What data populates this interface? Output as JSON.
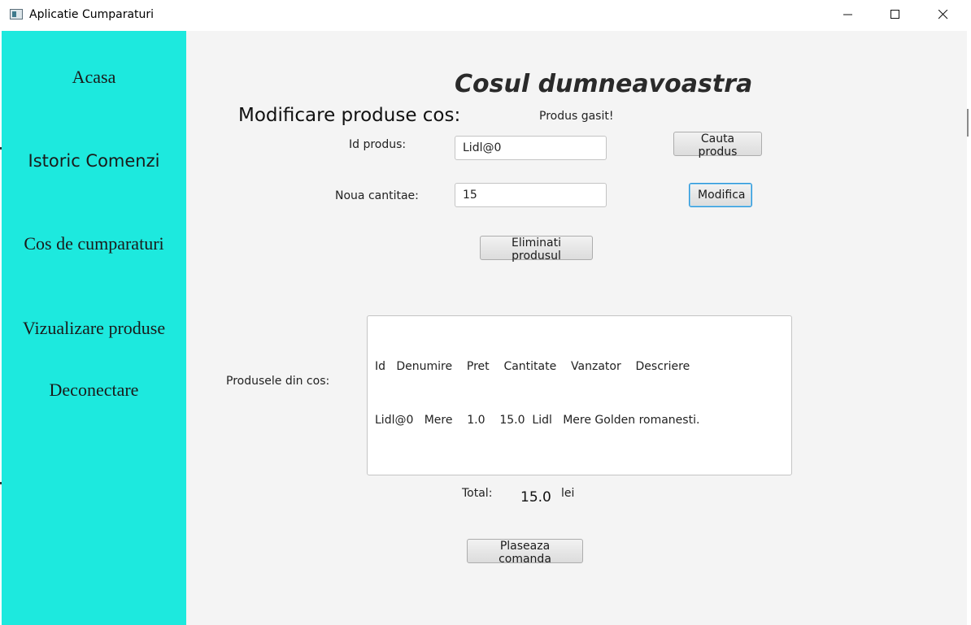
{
  "window": {
    "title": "Aplicatie Cumparaturi"
  },
  "sidebar": {
    "color": "#1de9de",
    "items": [
      {
        "label": "Acasa"
      },
      {
        "label": "Istoric Comenzi"
      },
      {
        "label": "Cos de cumparaturi"
      },
      {
        "label": "Vizualizare produse"
      },
      {
        "label": "Deconectare"
      }
    ]
  },
  "main": {
    "title": "Cosul dumneavoastra",
    "section_title": "Modificare produse cos:",
    "status": "Produs gasit!",
    "id_label": "Id produs:",
    "id_value": "Lidl@0",
    "quantity_label": "Noua cantitae:",
    "quantity_value": "15",
    "search_button": "Cauta produs",
    "modify_button": "Modifica",
    "remove_button": "Eliminati produsul",
    "cart_label": "Produsele din cos:",
    "cart_lines": [
      "Id   Denumire    Pret    Cantitate    Vanzator    Descriere",
      "Lidl@0   Mere    1.0    15.0  Lidl   Mere Golden romanesti."
    ],
    "total_label": "Total:",
    "total_value": "15.0",
    "currency": "lei",
    "order_button": "Plaseaza comanda"
  }
}
